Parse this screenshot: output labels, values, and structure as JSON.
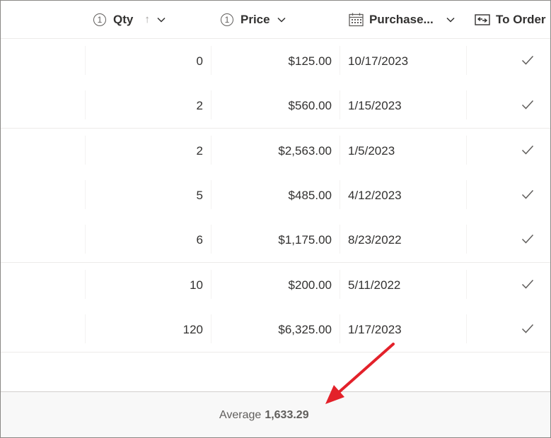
{
  "columns": {
    "qty": {
      "label": "Qty",
      "sort_glyph": "↑"
    },
    "price": {
      "label": "Price"
    },
    "purchase": {
      "label": "Purchase..."
    },
    "to_order": {
      "label": "To Order"
    }
  },
  "rows": [
    {
      "qty": "0",
      "price": "$125.00",
      "purchase": "10/17/2023",
      "to_order": true
    },
    {
      "qty": "2",
      "price": "$560.00",
      "purchase": "1/15/2023",
      "to_order": true
    },
    {
      "qty": "2",
      "price": "$2,563.00",
      "purchase": "1/5/2023",
      "to_order": true
    },
    {
      "qty": "5",
      "price": "$485.00",
      "purchase": "4/12/2023",
      "to_order": true
    },
    {
      "qty": "6",
      "price": "$1,175.00",
      "purchase": "8/23/2022",
      "to_order": true
    },
    {
      "qty": "10",
      "price": "$200.00",
      "purchase": "5/11/2022",
      "to_order": true
    },
    {
      "qty": "120",
      "price": "$6,325.00",
      "purchase": "1/17/2023",
      "to_order": true
    }
  ],
  "footer": {
    "aggregate_label": "Average",
    "aggregate_value": "1,633.29"
  },
  "colors": {
    "annotation_arrow": "#e3212a",
    "checkmark": "#605e5c"
  },
  "icons": {
    "qty": "number-icon",
    "price": "number-icon",
    "purchase": "calendar-icon",
    "to_order": "yes-no-icon"
  }
}
